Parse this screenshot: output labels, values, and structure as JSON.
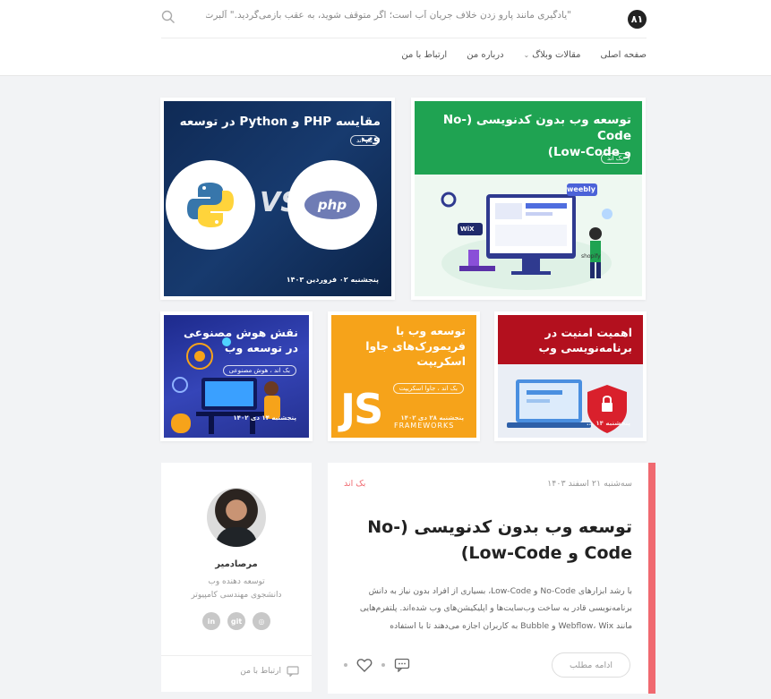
{
  "header": {
    "logo_text": "۸۱",
    "quote": "\"یادگیری مانند پارو زدن خلاف جریان آب است؛ اگر متوقف شوید، به عقب بازمی‌گردید.\" آلبرت انیشتین",
    "nav": [
      {
        "label": "صفحه اصلی"
      },
      {
        "label": "مقالات وبلاگ"
      },
      {
        "label": "درباره من"
      },
      {
        "label": "ارتباط با من"
      }
    ]
  },
  "featured": {
    "nocode": {
      "title_line1": "توسعه وب بدون کدنویسی (No-Code",
      "title_line2": "و Low-Code)",
      "tag": "بک اند",
      "illus_labels": [
        "weebly",
        "WiX",
        "shopify"
      ]
    },
    "php_python": {
      "title": "مقایسه PHP و Python در توسعه وب",
      "tag": "بک اند",
      "date": "پنجشنبه ۰۲ فروردین ۱۴۰۳",
      "php_label": "php",
      "vs_label": "VS"
    },
    "security": {
      "title_line1": "اهمیت امنیت در",
      "title_line2": "برنامه‌نویسی وب",
      "date": "پنجشنبه ۱۴ ..."
    },
    "js": {
      "title_line1": "توسعه وب با",
      "title_line2": "فریمورک‌های جاوا",
      "title_line3": "اسکریپت",
      "tag": "بک اند ، جاوا اسکریپت",
      "date": "پنجشنبه ۲۸ دی ۱۴۰۲",
      "logo_text": "JS",
      "sub_text": "FRAMEWORKS"
    },
    "ai": {
      "title_line1": "نقش هوش مصنوعی",
      "title_line2": "در توسعه وب",
      "tag": "بک اند ، هوش مصنوعی",
      "date": "پنجشنبه ۱۴ دی ۱۴۰۲"
    }
  },
  "post": {
    "date": "سه‌شنبه ۲۱ اسفند ۱۴۰۳",
    "category": "بک اند",
    "title": "توسعه وب بدون کدنویسی (No-Code و Low-Code)",
    "excerpt": "با رشد ابزارهای No-Code و Low-Code، بسیاری از افراد بدون نیاز به دانش برنامه‌نویسی قادر به ساخت وب‌سایت‌ها و اپلیکیشن‌های وب شده‌اند. پلتفرم‌هایی مانند Webflow، Wix و Bubble به کاربران اجازه می‌دهند تا با استفاده",
    "read_more": "ادامه مطلب"
  },
  "author": {
    "name": "مرصادمیر",
    "role": "توسعه دهنده وب",
    "education": "دانشجوی مهندسی کامپیوتر",
    "socials": [
      {
        "label": "in",
        "icon": "linkedin-icon"
      },
      {
        "label": "git",
        "icon": "git-icon"
      },
      {
        "label": "◎",
        "icon": "instagram-icon"
      }
    ],
    "contact": "ارتباط با من"
  },
  "colors": {
    "accent": "#f06970",
    "navy": "#173a6e",
    "green": "#1fa352",
    "orange": "#f6a31a",
    "red": "#b3101e"
  }
}
